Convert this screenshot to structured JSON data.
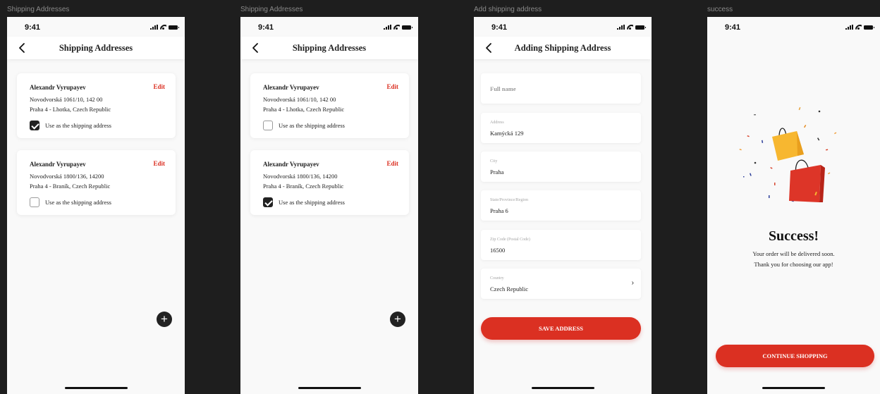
{
  "status_time": "9:41",
  "colors": {
    "accent": "#DB3022",
    "background": "#F9F9F9",
    "canvas": "#1E1E1E"
  },
  "icons": {
    "back": "chevron-left-icon",
    "add": "plus-icon",
    "country": "chevron-right-icon",
    "signal": "signal-icon",
    "wifi": "wifi-icon",
    "battery": "battery-icon",
    "illustration": "shopping-bags-illustration"
  },
  "frames": [
    {
      "label": "Shipping Addresses",
      "title": "Shipping Addresses",
      "addresses": [
        {
          "name": "Alexandr Vyrupayev",
          "edit": "Edit",
          "line1": "Novodvorská 1061/10, 142 00",
          "line2": "Praha 4 - Lhotka, Czech Republic",
          "checkbox_label": "Use as the shipping address",
          "checked": true
        },
        {
          "name": "Alexandr Vyrupayev",
          "edit": "Edit",
          "line1": "Novodvorská 1800/136, 14200",
          "line2": "Praha 4 - Braník, Czech Republic",
          "checkbox_label": "Use as the shipping address",
          "checked": false
        }
      ]
    },
    {
      "label": "Shipping Addresses",
      "title": "Shipping Addresses",
      "addresses": [
        {
          "name": "Alexandr Vyrupayev",
          "edit": "Edit",
          "line1": "Novodvorská 1061/10, 142 00",
          "line2": "Praha 4 - Lhotka, Czech Republic",
          "checkbox_label": "Use as the shipping address",
          "checked": false
        },
        {
          "name": "Alexandr Vyrupayev",
          "edit": "Edit",
          "line1": "Novodvorská 1800/136, 14200",
          "line2": "Praha 4 - Braník, Czech Republic",
          "checkbox_label": "Use as the shipping address",
          "checked": true
        }
      ]
    },
    {
      "label": "Add shipping address",
      "title": "Adding Shipping Address",
      "fields": [
        {
          "label": "",
          "placeholder": "Full name",
          "value": ""
        },
        {
          "label": "Address",
          "value": "Kamýcká 129"
        },
        {
          "label": "City",
          "value": "Praha"
        },
        {
          "label": "State/Province/Region",
          "value": "Praha 6"
        },
        {
          "label": "Zip Code (Postal Code)",
          "value": "16500"
        },
        {
          "label": "Country",
          "value": "Czech Republic"
        }
      ],
      "save_button": "SAVE ADDRESS"
    },
    {
      "label": "success",
      "title": "Success!",
      "message_line1": "Your order will be delivered soon.",
      "message_line2": "Thank you for choosing our app!",
      "continue_button": "CONTINUE SHOPPING"
    }
  ]
}
